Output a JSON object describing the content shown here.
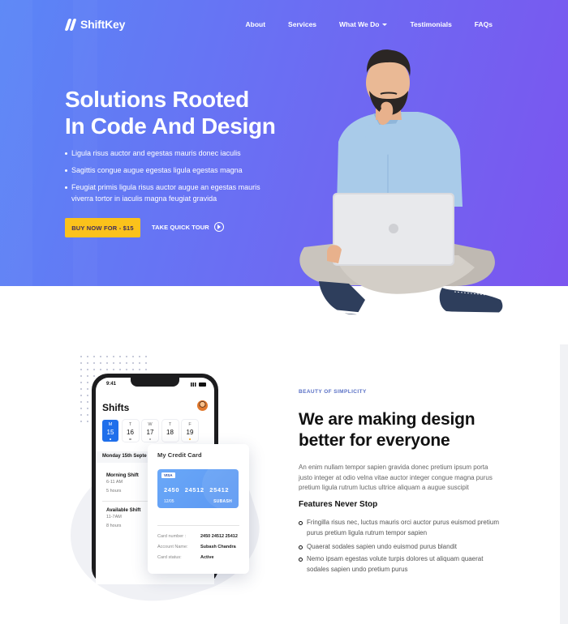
{
  "brand": {
    "name": "ShiftKey"
  },
  "nav": {
    "items": [
      "About",
      "Services",
      "What We Do",
      "Testimonials",
      "FAQs"
    ]
  },
  "hero": {
    "title_line1": "Solutions Rooted",
    "title_line2": "In Code And Design",
    "bullets": [
      "Ligula risus auctor and egestas mauris donec iaculis",
      "Sagittis congue augue egestas ligula egestas magna",
      "Feugiat primis ligula risus auctor augue an egestas mauris viverra tortor in iaculis magna feugiat gravida"
    ],
    "buy_label": "BUY NOW FOR - $15",
    "tour_label": "TAKE QUICK TOUR"
  },
  "phone": {
    "time": "9:41",
    "title": "Shifts",
    "days": [
      {
        "label": "M",
        "num": "15"
      },
      {
        "label": "T",
        "num": "16"
      },
      {
        "label": "W",
        "num": "17"
      },
      {
        "label": "T",
        "num": "18"
      },
      {
        "label": "F",
        "num": "19"
      }
    ],
    "date_label": "Monday 15th Septe",
    "shifts": [
      {
        "name": "Morning Shift",
        "time": "6-11 AM",
        "hours": "5 hours"
      },
      {
        "name": "Available Shift",
        "time": "11-7AM",
        "hours": "8 hours"
      }
    ]
  },
  "credit": {
    "title": "My Credit Card",
    "brand": "VISA",
    "number": "2450  24512  25412",
    "expiry": "12/05",
    "holder": "SUBASH",
    "rows": [
      {
        "label": "Card number :",
        "value": "2450 24512 25412"
      },
      {
        "label": "Account Name:",
        "value": "Subash Chandra"
      },
      {
        "label": "Card status:",
        "value": "Active"
      }
    ]
  },
  "section": {
    "eyebrow": "BEAUTY OF SIMPLICITY",
    "title_line1": "We are making design",
    "title_line2": "better for everyone",
    "description": "An enim nullam tempor sapien gravida donec pretium ipsum porta justo integer at odio velna vitae auctor integer congue magna purus pretium ligula rutrum luctus ultrice aliquam a augue suscipit",
    "features_title": "Features Never Stop",
    "features": [
      "Fringilla risus nec, luctus mauris orci auctor purus euismod pretium purus pretium ligula rutrum tempor sapien",
      "Quaerat sodales sapien undo euismod purus blandit",
      "Nemo ipsam egestas volute turpis dolores ut aliquam quaerat sodales sapien undo pretium purus"
    ]
  },
  "colors": {
    "hero_start": "#5a86f6",
    "hero_end": "#7b55ef",
    "cta": "#fbc21b",
    "accent_blue": "#1f6feb",
    "eyebrow": "#5a71c6"
  }
}
